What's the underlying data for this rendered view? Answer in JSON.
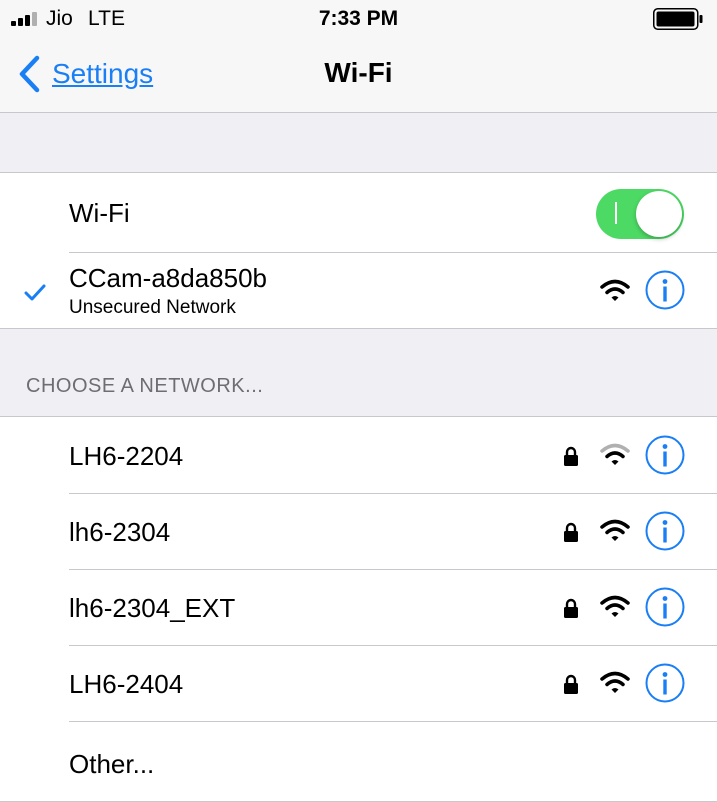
{
  "status_bar": {
    "carrier": "Jio",
    "network": "LTE",
    "time": "7:33 PM",
    "signal_bars_filled": 3,
    "signal_bars_total": 4,
    "battery_level": 0.9
  },
  "nav": {
    "back_label": "Settings",
    "title": "Wi-Fi"
  },
  "wifi_toggle": {
    "label": "Wi-Fi",
    "on": true
  },
  "connected": {
    "name": "CCam-a8da850b",
    "subtitle": "Unsecured Network"
  },
  "section_header": "CHOOSE A NETWORK...",
  "networks": [
    {
      "name": "LH6-2204",
      "secured": true
    },
    {
      "name": "lh6-2304",
      "secured": true
    },
    {
      "name": "lh6-2304_EXT",
      "secured": true
    },
    {
      "name": "LH6-2404",
      "secured": true
    }
  ],
  "other_label": "Other...",
  "colors": {
    "accent": "#1a7ef5",
    "toggle_on": "#4cd964",
    "background": "#efeff4",
    "separator": "#c8c7cc"
  }
}
